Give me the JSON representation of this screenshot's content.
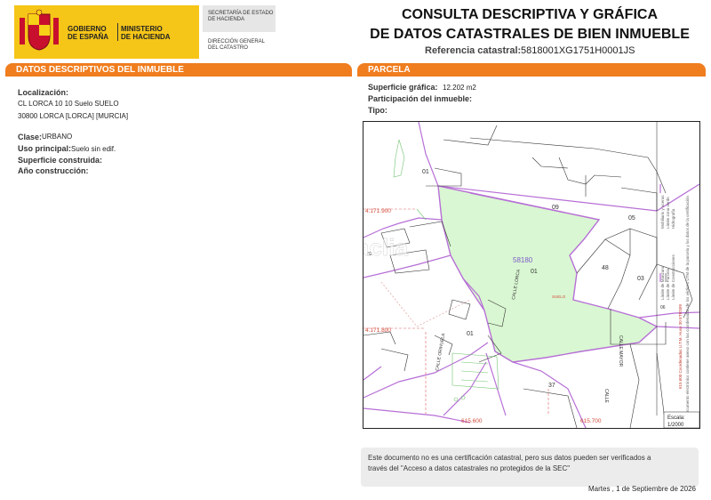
{
  "header": {
    "ministry_left": [
      "GOBIERNO",
      "DE ESPAÑA"
    ],
    "ministry_right": [
      "MINISTERIO",
      "DE HACIENDA"
    ],
    "secretaria": [
      "SECRETARÍA DE ESTADO",
      "DE HACIENDA"
    ],
    "direccion": [
      "DIRECCIÓN GENERAL",
      "DEL CATASTRO"
    ],
    "title_line1": "CONSULTA DESCRIPTIVA Y GRÁFICA",
    "title_line2": "DE DATOS CATASTRALES DE BIEN INMUEBLE",
    "ref_label": "Referencia catastral:",
    "ref_value": "5818001XG1751H0001JS",
    "brand_color": "#f5c518"
  },
  "left_panel": {
    "title": "DATOS DESCRIPTIVOS DEL INMUEBLE",
    "localizacion_label": "Localización:",
    "localizacion_line1": "CL LORCA 10 10 Suelo SUELO",
    "localizacion_line2": "30800 LORCA [LORCA] [MURCIA]",
    "clase_label": "Clase:",
    "clase_value": "URBANO",
    "uso_label": "Uso principal:",
    "uso_value": "Suelo sin edif.",
    "superficie_label": "Superficie construida:",
    "anio_label": "Año construcción:"
  },
  "right_panel": {
    "title": "PARCELA",
    "superficie_label": "Superficie gráfica:",
    "superficie_value": "12.202 m2",
    "participacion_label": "Participación del inmueble:",
    "tipo_label": "Tipo:"
  },
  "map": {
    "parcel_fill": "#d9f7d2",
    "boundary_color": "#b76fd6",
    "parcel_id": "58180",
    "parcel_sub": "01",
    "suelo_label": "SUELO",
    "coord_top_left": "4.171.900",
    "coord_mid_left": "4.171.800",
    "coord_bottom_1": "615.600",
    "coord_bottom_2": "615.700",
    "street_1": "CALLE LORCA",
    "street_2": "CALLE ORIHUELA",
    "street_3": "CALLE",
    "street_4": "CALLE MAYOR",
    "plot_numbers": [
      "01",
      "09",
      "05",
      "48",
      "03",
      "01",
      "37",
      "02",
      "06"
    ],
    "scale_label": "Escala:",
    "scale_value": "1/2000",
    "watermark": "habitaclia",
    "legend_text_1": "615.600 Coordenadas U.T.M. Huso 30 ETRS89",
    "legend_text_2": "Este documento electrónico contiene anexo con las coordenadas de los vértices UTM de la parcela y los datos de la certificación",
    "legend_text_3": "Límite de Manzana",
    "legend_text_4": "Límite de Parcela",
    "legend_text_5": "Límite de Construcciones",
    "legend_text_6": "Mobiliario y aceras",
    "legend_text_7": "Límite zona verde",
    "legend_text_8": "Hidrografía"
  },
  "footer": {
    "notice_line1": "Este documento no es una certificación catastral, pero sus datos pueden ser verificados a",
    "notice_line2": "través del \"Acceso a datos catastrales no protegidos de la SEC\"",
    "date": "Martes , 1 de Septiembre de 2026"
  }
}
